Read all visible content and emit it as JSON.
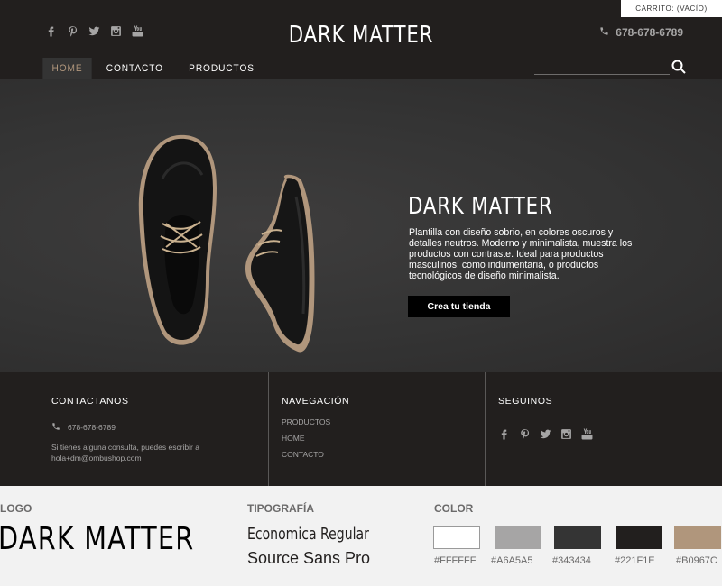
{
  "header": {
    "cart_label": "CARRITO: (VACÍO)",
    "brand": "DARK MATTER",
    "phone": "678-678-6789",
    "social_icons": [
      "facebook-icon",
      "pinterest-icon",
      "twitter-icon",
      "instagram-icon",
      "youtube-icon"
    ],
    "nav": [
      {
        "label": "HOME",
        "active": true
      },
      {
        "label": "CONTACTO",
        "active": false
      },
      {
        "label": "PRODUCTOS",
        "active": false
      }
    ],
    "search": {
      "value": "",
      "placeholder": ""
    }
  },
  "hero": {
    "title": "DARK MATTER",
    "text": "Plantilla con diseño sobrio, en colores oscuros y detalles neutros. Moderno y minimalista, muestra los productos con contraste. Ideal para productos masculinos, como indumentaria, o productos tecnológicos de diseño minimalista.",
    "cta": "Crea tu tienda"
  },
  "footer": {
    "contact": {
      "title": "CONTACTANOS",
      "phone": "678-678-6789",
      "note": "Si tienes alguna consulta, puedes escribir a hola+dm@ombushop.com"
    },
    "navigation": {
      "title": "NAVEGACIÓN",
      "links": [
        "PRODUCTOS",
        "HOME",
        "CONTACTO"
      ]
    },
    "follow": {
      "title": "SEGUINOS",
      "icons": [
        "facebook-icon",
        "pinterest-icon",
        "twitter-icon",
        "instagram-icon",
        "youtube-icon"
      ]
    }
  },
  "style_guide": {
    "logo_heading": "LOGO",
    "logo_text": "DARK MATTER",
    "typography_heading": "TIPOGRAFÍA",
    "font_samples": [
      "Economica Regular",
      "Source Sans Pro"
    ],
    "color_heading": "COLOR",
    "colors": [
      {
        "hex": "#FFFFFF",
        "label": "#FFFFFF"
      },
      {
        "hex": "#A6A5A5",
        "label": "#A6A5A5"
      },
      {
        "hex": "#343434",
        "label": "#343434"
      },
      {
        "hex": "#221F1E",
        "label": "#221F1E"
      },
      {
        "hex": "#B0967C",
        "label": "#B0967C"
      }
    ]
  },
  "theme": {
    "header_bg": "#221F1E",
    "hero_bg": "#343434",
    "accent": "#B0967C",
    "muted": "#A6A5A5"
  }
}
